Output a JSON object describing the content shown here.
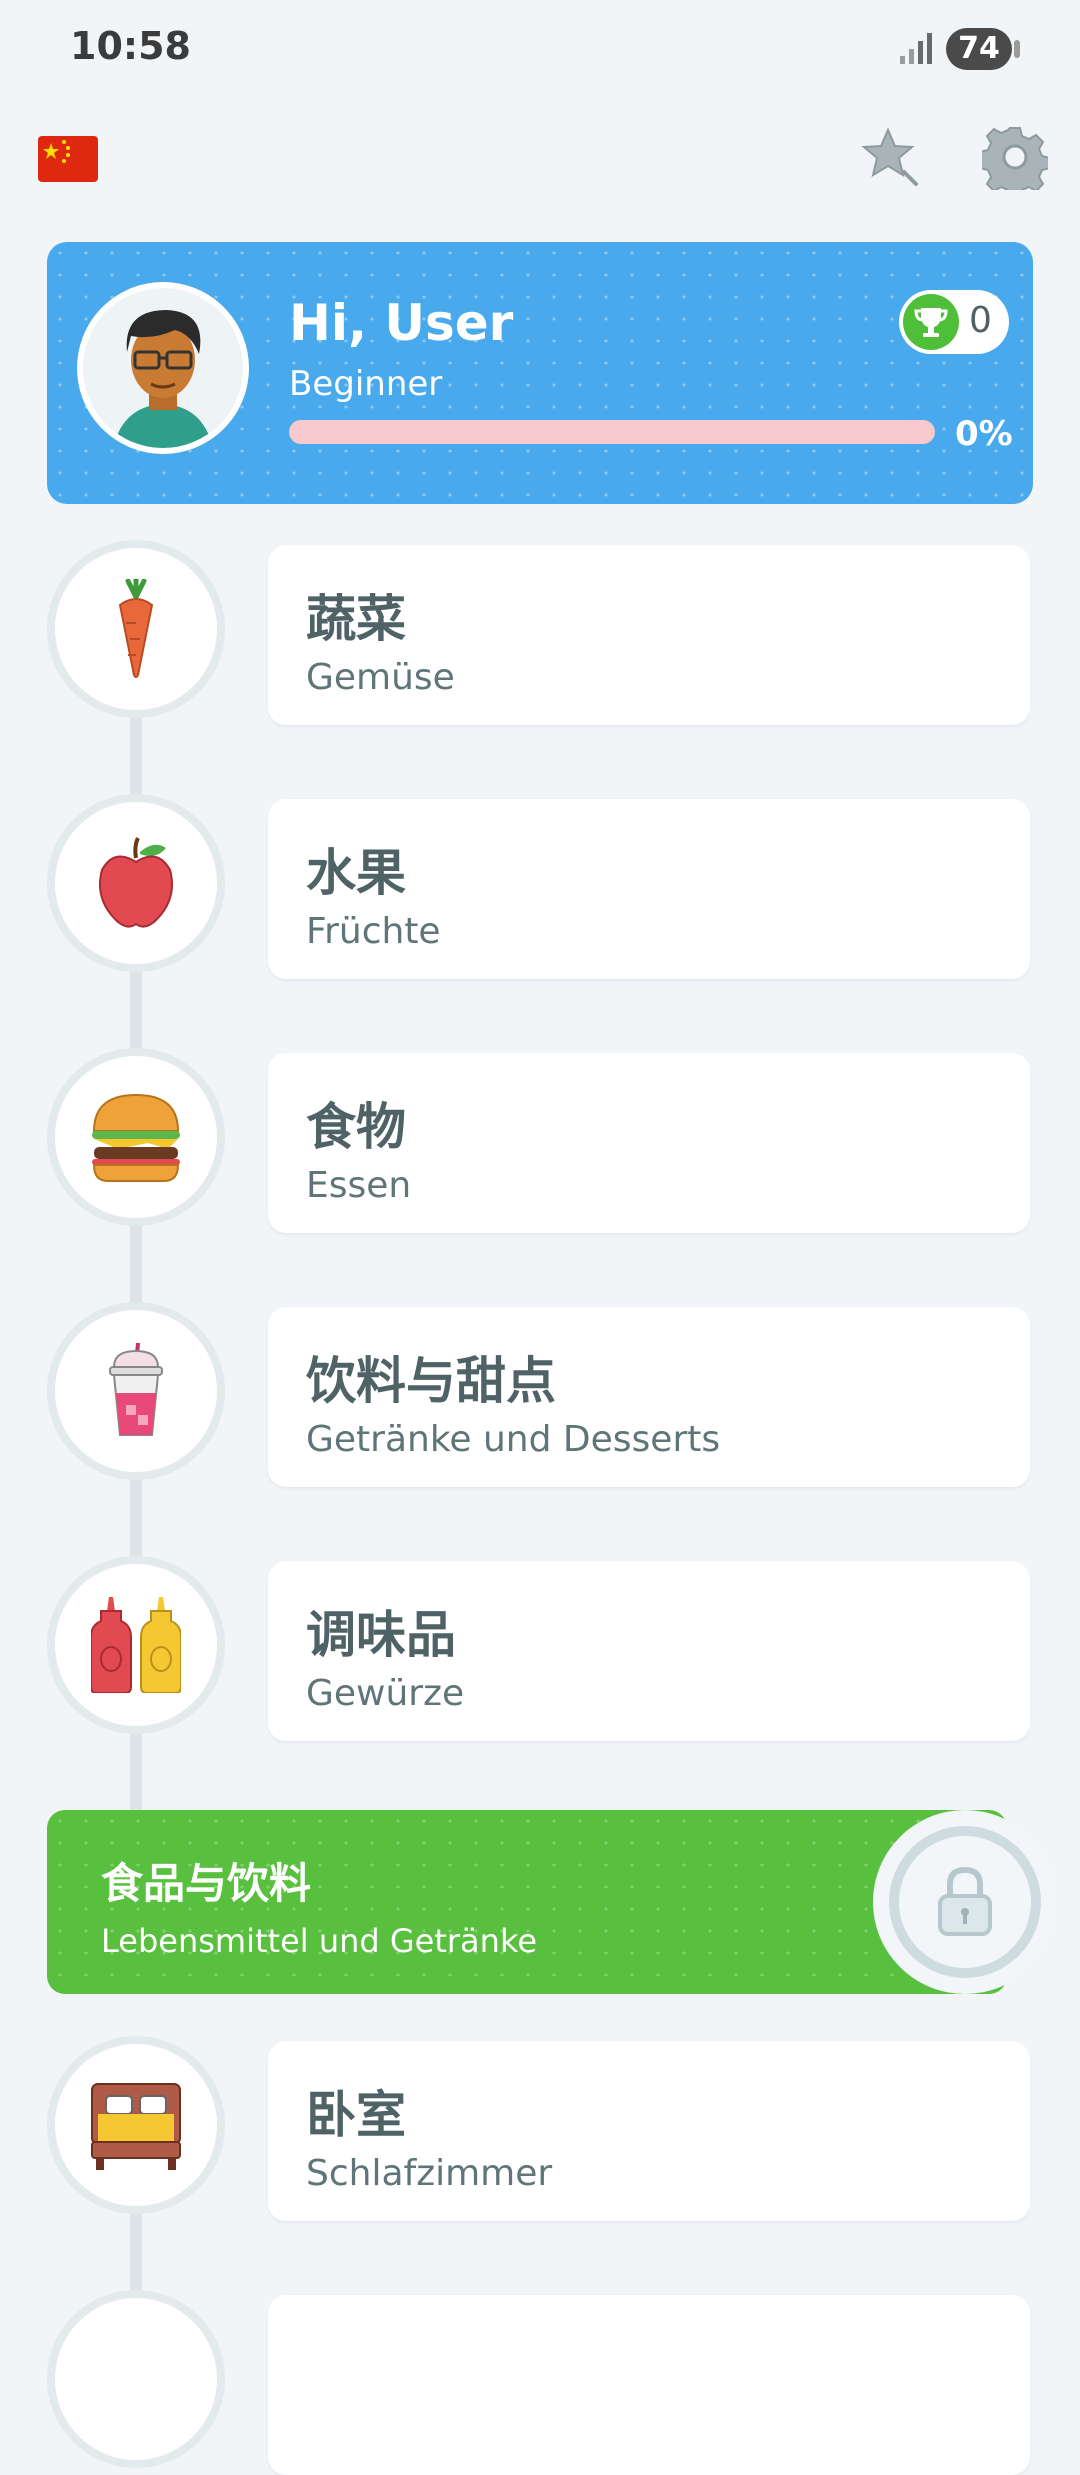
{
  "status_bar": {
    "time": "10:58",
    "battery": "74"
  },
  "profile": {
    "greeting": "Hi, User",
    "level": "Beginner",
    "progress_percent": 0,
    "progress_label": "0%",
    "trophies": "0"
  },
  "lessons": [
    {
      "title": "蔬菜",
      "subtitle": "Gemüse",
      "icon": "carrot-icon"
    },
    {
      "title": "水果",
      "subtitle": "Früchte",
      "icon": "apple-icon"
    },
    {
      "title": "食物",
      "subtitle": "Essen",
      "icon": "burger-icon"
    },
    {
      "title": "饮料与甜点",
      "subtitle": "Getränke und Desserts",
      "icon": "drink-icon"
    },
    {
      "title": "调味品",
      "subtitle": "Gewürze",
      "icon": "condiments-icon"
    }
  ],
  "section_banner": {
    "title": "食品与饮料",
    "subtitle": "Lebensmittel und Getränke",
    "icon": "lock-icon"
  },
  "next_lessons": [
    {
      "title": "卧室",
      "subtitle": "Schlafzimmer",
      "icon": "bed-icon"
    }
  ],
  "colors": {
    "profile_bg": "#48a9ec",
    "banner_bg": "#58c03e",
    "progress_track": "#f8c9cc",
    "trophy": "#4fbf3a"
  }
}
